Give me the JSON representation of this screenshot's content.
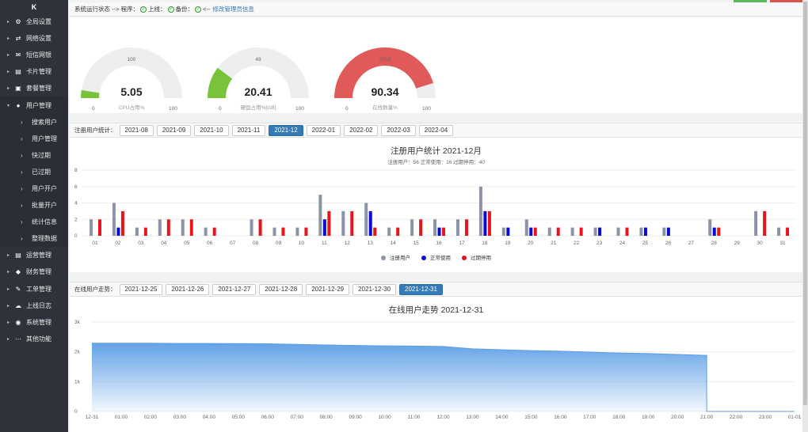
{
  "sidebar": {
    "logo": "K",
    "items": [
      {
        "label": "全局设置",
        "icon": "gear-icon",
        "glyph": "⚙"
      },
      {
        "label": "网络设置",
        "icon": "network-icon",
        "glyph": "⇄"
      },
      {
        "label": "短信网银",
        "icon": "envelope-icon",
        "glyph": "✉"
      },
      {
        "label": "卡片管理",
        "icon": "card-icon",
        "glyph": "▤"
      },
      {
        "label": "套餐管理",
        "icon": "cart-icon",
        "glyph": "▣"
      },
      {
        "label": "用户管理",
        "icon": "user-icon",
        "glyph": "●",
        "expanded": true
      }
    ],
    "subitems": [
      "搜索用户",
      "用户管理",
      "快过期",
      "已过期",
      "用户开户",
      "批量开户",
      "统计信息",
      "整理数据"
    ],
    "items2": [
      {
        "label": "运营管理",
        "icon": "list-icon",
        "glyph": "▤"
      },
      {
        "label": "财务管理",
        "icon": "finance-icon",
        "glyph": "◆"
      },
      {
        "label": "工单管理",
        "icon": "wrench-icon",
        "glyph": "✎"
      },
      {
        "label": "上线日志",
        "icon": "log-icon",
        "glyph": "☁"
      },
      {
        "label": "系统管理",
        "icon": "globe-icon",
        "glyph": "◉"
      },
      {
        "label": "其他功能",
        "icon": "ellipsis-icon",
        "glyph": "⋯"
      }
    ]
  },
  "status": {
    "prefix": "系统运行状态 --> 程序：",
    "online": "上线：",
    "backup": "备份：",
    "arrow": "<--",
    "link": "修改管理员信息"
  },
  "gauges": [
    {
      "value": 5.05,
      "display": "5.05",
      "max": "100",
      "min": "0",
      "name": "CPU占用%",
      "color": "#79c33b"
    },
    {
      "value": 20.41,
      "display": "20.41",
      "max": "49",
      "min": "0",
      "name": "硬盘占用%[GB]",
      "color": "#79c33b"
    },
    {
      "value": 90.34,
      "display": "90.34",
      "max": "2019",
      "min": "0",
      "name": "在线数量%",
      "color": "#e05a5a"
    }
  ],
  "gauge_scale_max": "100",
  "reg_tabs": {
    "label": "注册用户统计：",
    "items": [
      "2021-08",
      "2021-09",
      "2021-10",
      "2021-11",
      "2021-12",
      "2022-01",
      "2022-02",
      "2022-03",
      "2022-04"
    ],
    "active": "2021-12"
  },
  "online_tabs": {
    "label": "在线用户走势：",
    "items": [
      "2021-12-25",
      "2021-12-26",
      "2021-12-27",
      "2021-12-28",
      "2021-12-29",
      "2021-12-30",
      "2021-12-31"
    ],
    "active": "2021-12-31"
  },
  "chart_data": [
    {
      "type": "bar",
      "title": "注册用户统计 2021-12月",
      "subtitle": "注册用户：56 正常使用：16 过期停用：40",
      "categories": [
        "01",
        "02",
        "03",
        "04",
        "05",
        "06",
        "07",
        "08",
        "09",
        "10",
        "11",
        "12",
        "13",
        "14",
        "15",
        "16",
        "17",
        "18",
        "19",
        "20",
        "21",
        "22",
        "23",
        "24",
        "25",
        "26",
        "27",
        "28",
        "29",
        "30",
        "31"
      ],
      "ylim": [
        0,
        8
      ],
      "yticks": [
        0,
        2,
        4,
        6,
        8
      ],
      "series": [
        {
          "name": "注册用户",
          "color": "#8b93a8",
          "values": [
            2,
            4,
            1,
            2,
            2,
            1,
            0,
            2,
            1,
            1,
            5,
            3,
            4,
            1,
            2,
            2,
            2,
            6,
            1,
            2,
            1,
            1,
            1,
            1,
            1,
            1,
            0,
            2,
            0,
            3,
            1
          ]
        },
        {
          "name": "正常使用",
          "color": "#0b0bd6",
          "values": [
            0,
            1,
            0,
            0,
            0,
            0,
            0,
            0,
            0,
            0,
            2,
            0,
            3,
            0,
            0,
            1,
            0,
            3,
            1,
            1,
            0,
            0,
            1,
            0,
            1,
            1,
            0,
            1,
            0,
            0,
            0
          ]
        },
        {
          "name": "过期停用",
          "color": "#e8141b",
          "values": [
            2,
            3,
            1,
            2,
            2,
            1,
            0,
            2,
            1,
            1,
            3,
            3,
            1,
            1,
            2,
            1,
            2,
            3,
            0,
            1,
            1,
            1,
            0,
            1,
            0,
            0,
            0,
            1,
            0,
            3,
            1
          ]
        }
      ]
    },
    {
      "type": "area",
      "title": "在线用户走势 2021-12-31",
      "x": [
        "12-31",
        "01:00",
        "02:00",
        "03:00",
        "04:00",
        "05:00",
        "06:00",
        "07:00",
        "08:00",
        "09:00",
        "10:00",
        "11:00",
        "12:00",
        "13:00",
        "14:00",
        "15:00",
        "16:00",
        "17:00",
        "18:00",
        "19:00",
        "20:00",
        "21:00",
        "22:00",
        "23:00",
        "01-01"
      ],
      "values": [
        2290,
        2290,
        2290,
        2280,
        2280,
        2275,
        2270,
        2250,
        2230,
        2215,
        2200,
        2195,
        2180,
        2100,
        2070,
        2040,
        2020,
        1990,
        1960,
        1940,
        1910,
        1880,
        0,
        0,
        0
      ],
      "ylim": [
        0,
        3000
      ],
      "yticks": [
        "0",
        "1k",
        "2k",
        "3k"
      ],
      "color": "#5b9de6"
    }
  ]
}
